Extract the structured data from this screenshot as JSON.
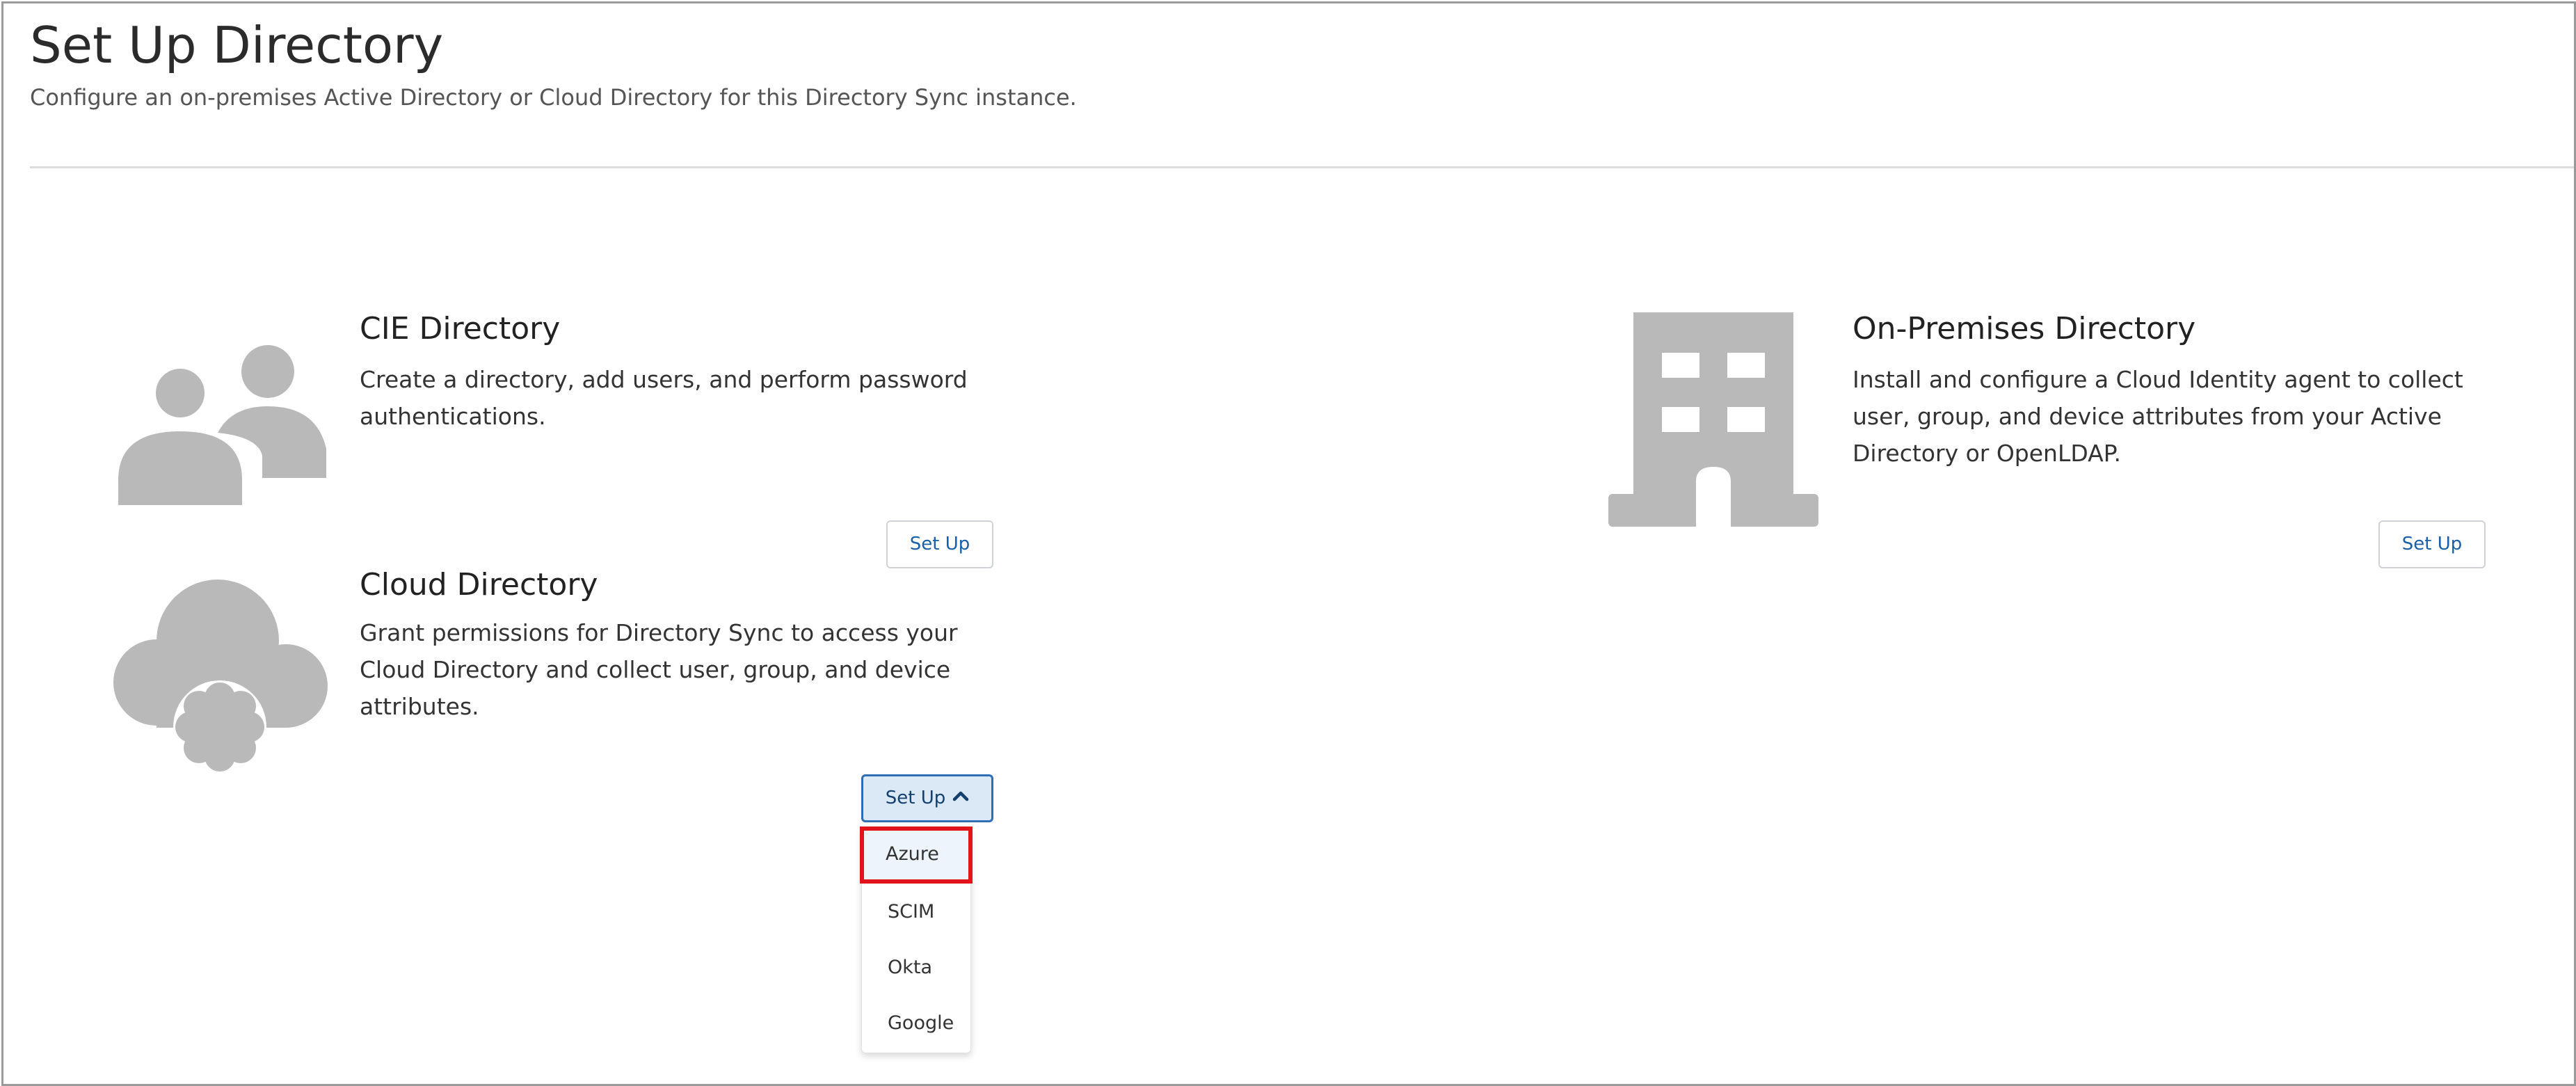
{
  "header": {
    "title": "Set Up Directory",
    "subtitle": "Configure an on-premises Active Directory or Cloud Directory for this Directory Sync instance."
  },
  "cards": {
    "cie": {
      "icon": "users-icon",
      "title": "CIE Directory",
      "description": "Create a directory, add users, and perform password authentications.",
      "button_label": "Set Up"
    },
    "cloud": {
      "icon": "cloud-gear-icon",
      "title": "Cloud Directory",
      "description": "Grant permissions for Directory Sync to access your Cloud Directory and collect user, group, and device attributes.",
      "button_label": "Set Up",
      "dropdown_open": true,
      "options": [
        "Azure",
        "SCIM",
        "Okta",
        "Google"
      ],
      "highlighted_option": "Azure"
    },
    "onprem": {
      "icon": "building-icon",
      "title": "On-Premises Directory",
      "description": "Install and configure a Cloud Identity agent to collect user, group, and device attributes from your Active Directory or OpenLDAP.",
      "button_label": "Set Up"
    }
  },
  "colors": {
    "icon_gray": "#b9b9b9",
    "link_blue": "#1a5fa8",
    "active_button_bg": "#dbe8f6",
    "highlight_red": "#e0141a"
  }
}
